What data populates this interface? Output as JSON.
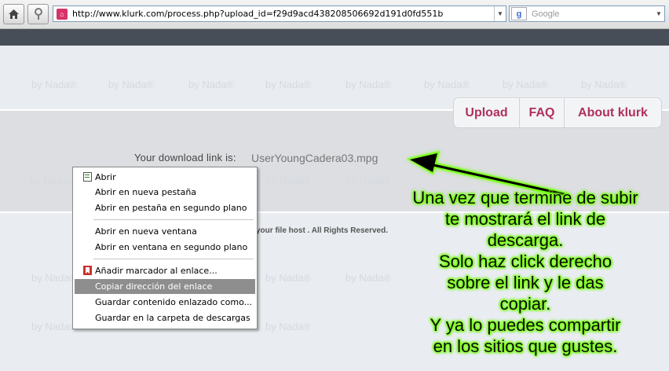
{
  "browser": {
    "url": "http://www.klurk.com/process.php?upload_id=f29d9acd438208506692d191d0fd551b",
    "search_placeholder": "Google",
    "home_icon": "home-icon",
    "info_icon": "info-icon"
  },
  "watermark": "by Nada®",
  "nav": {
    "items": [
      "Upload",
      "FAQ",
      "About klurk"
    ]
  },
  "download": {
    "label": "Your download link is:",
    "link": "UserYoungCadera03.mpg"
  },
  "footer": {
    "text": "your file host . All Rights Reserved."
  },
  "context_menu": {
    "items": [
      {
        "label": "Abrir"
      },
      {
        "label": "Abrir en nueva pestaña"
      },
      {
        "label": "Abrir en pestaña en segundo plano"
      },
      {
        "label": "Abrir en nueva ventana"
      },
      {
        "label": "Abrir en ventana en segundo plano"
      },
      {
        "label": "Añadir marcador al enlace..."
      },
      {
        "label": "Copiar dirección del enlace"
      },
      {
        "label": "Guardar contenido enlazado como..."
      },
      {
        "label": "Guardar en la carpeta de descargas"
      }
    ],
    "selected": "Copiar dirección del enlace"
  },
  "annotation": {
    "lines": [
      "Una vez que termine de subir",
      "te mostrará el link de",
      "descarga.",
      "Solo haz click derecho",
      "sobre el link y le das",
      "copiar.",
      "Y ya lo puedes compartir",
      "en los sitios que gustes."
    ],
    "glow_color": "#7cff1a"
  },
  "colors": {
    "nav_text": "#b03060",
    "toolbar_dark": "#474e57",
    "menu_highlight": "#8e8e8e"
  }
}
